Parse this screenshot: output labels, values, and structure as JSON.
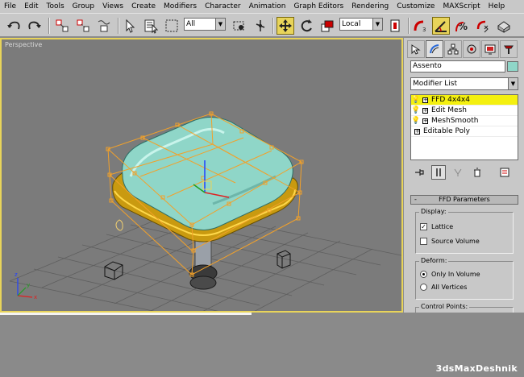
{
  "menu": [
    "File",
    "Edit",
    "Tools",
    "Group",
    "Views",
    "Create",
    "Modifiers",
    "Character",
    "Animation",
    "Graph Editors",
    "Rendering",
    "Customize",
    "MAXScript",
    "Help"
  ],
  "toolbar": {
    "selection_filter": "All",
    "reference_coord": "Local",
    "icons": [
      "undo-icon",
      "redo-icon",
      "select-and-link-icon",
      "unlink-selection-icon",
      "bind-to-space-warp-icon",
      "select-object-icon",
      "select-by-name-icon",
      "rectangular-selection-icon",
      "window-crossing-icon",
      "select-and-move-icon",
      "select-and-rotate-icon",
      "select-and-scale-icon",
      "use-pivot-point-icon",
      "select-and-manipulate-icon",
      "snaps-toggle-icon",
      "angle-snap-icon",
      "percent-snap-icon",
      "spinner-snap-icon",
      "render-teapot-icon"
    ],
    "active_tool": "select-and-move-icon"
  },
  "viewport": {
    "label": "Perspective"
  },
  "command_panel": {
    "tabs": [
      "create-tab-icon",
      "modify-tab-icon",
      "hierarchy-tab-icon",
      "motion-tab-icon",
      "display-tab-icon",
      "utilities-tab-icon"
    ],
    "object_name": "Assento",
    "object_color": "#8fd6c8",
    "modifier_list": "Modifier List",
    "stack": [
      {
        "label": "FFD 4x4x4",
        "selected": true
      },
      {
        "label": "Edit Mesh",
        "selected": false
      },
      {
        "label": "MeshSmooth",
        "selected": false
      },
      {
        "label": "Editable Poly",
        "selected": false
      }
    ],
    "rollout": {
      "title": "FFD Parameters",
      "collapse": "-",
      "display_group": "Display:",
      "lattice": "Lattice",
      "source_volume": "Source Volume",
      "deform_group": "Deform:",
      "only_in_volume": "Only In Volume",
      "all_vertices": "All Vertices",
      "control_points_group": "Control Points:"
    }
  },
  "watermark": "3dsMaxDeshnik",
  "colors": {
    "accent": "#e8d45a",
    "selected_row": "#f4f010",
    "cushion": "#8fd6c8",
    "rim": "#d9a800",
    "lattice": "#f2a12a"
  }
}
